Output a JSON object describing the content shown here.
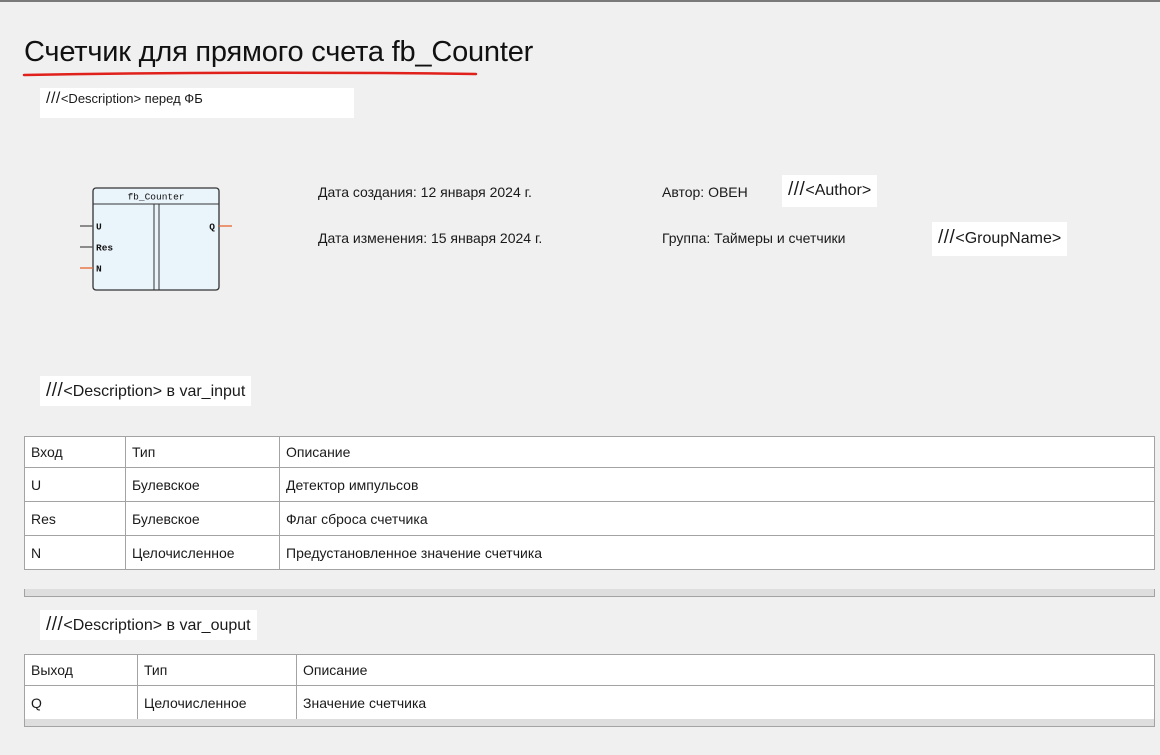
{
  "title": "Счетчик для прямого счета fb_Counter",
  "fb_annotation": {
    "prefix": "///",
    "text": "<Description> перед ФБ"
  },
  "block": {
    "name": "fb_Counter",
    "inputs": [
      "U",
      "Res",
      "N"
    ],
    "outputs": [
      "Q"
    ]
  },
  "meta": {
    "created": "Дата создания: 12 января 2024 г.",
    "modified": "Дата изменения: 15 января 2024 г.",
    "author": "Автор: ОВЕН",
    "group": "Группа: Таймеры и счетчики"
  },
  "author_annotation": {
    "prefix": "///",
    "text": "<Author>"
  },
  "group_annotation": {
    "prefix": "///",
    "text": "<GroupName>"
  },
  "input_annotation": {
    "prefix": "///",
    "text": "<Description> в var_input"
  },
  "output_annotation": {
    "prefix": "///",
    "text": "<Description> в var_ouput"
  },
  "inputs_table": {
    "headers": [
      "Вход",
      "Тип",
      "Описание"
    ],
    "rows": [
      [
        "U",
        "Булевское",
        "Детектор импульсов"
      ],
      [
        "Res",
        "Булевское",
        "Флаг сброса счетчика"
      ],
      [
        "N",
        "Целочисленное",
        "Предустановленное значение счетчика"
      ]
    ]
  },
  "outputs_table": {
    "headers": [
      "Выход",
      "Тип",
      "Описание"
    ],
    "rows": [
      [
        "Q",
        "Целочисленное",
        "Значение счетчика"
      ]
    ]
  },
  "colors": {
    "underline": "#e0201b",
    "pin_active": "#e8662e",
    "pin_default": "#555555",
    "block_fill": "#eaf4fb",
    "block_border": "#333333"
  }
}
